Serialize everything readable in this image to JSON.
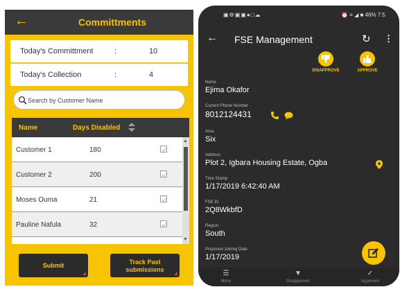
{
  "left_screen": {
    "title": "Committments",
    "stats": [
      {
        "label": "Today's Committment",
        "sep": ":",
        "value": "10"
      },
      {
        "label": "Today's Collection",
        "sep": ":",
        "value": "4"
      }
    ],
    "search": {
      "placeholder": "Search by Customer Name"
    },
    "table": {
      "headers": {
        "name": "Name",
        "days": "Days Disabled"
      },
      "rows": [
        {
          "name": "Customer 1",
          "days": "180"
        },
        {
          "name": "Customer 2",
          "days": "200"
        },
        {
          "name": "Moses Ouma",
          "days": "21"
        },
        {
          "name": "Pauline Nafula",
          "days": "32"
        }
      ]
    },
    "buttons": {
      "submit": "Submit",
      "track_line1": "Track Past",
      "track_line2": "submissions"
    }
  },
  "right_screen": {
    "status_left": "▣⚙▣▣●□☁",
    "status_right": "⏰ ≡ ◢ ■ 46% 7:5",
    "title": "FSE Management",
    "actions": {
      "disapprove": "DISAPPROVE",
      "approve": "APPROVE"
    },
    "fields": [
      {
        "label": "Name",
        "value": "Ejima Okafor"
      },
      {
        "label": "Current Phone Number",
        "value": "8012124431"
      },
      {
        "label": "Area",
        "value": "Six"
      },
      {
        "label": "Address",
        "value": "Plot 2, Igbara Housing Estate, Ogba"
      },
      {
        "label": "Time Stamp",
        "value": "1/17/2019 6:42:40 AM"
      },
      {
        "label": "FSE ID",
        "value": "2Q8WkbfD"
      },
      {
        "label": "Region",
        "value": "South"
      },
      {
        "label": "Proposed Joining Date",
        "value": "1/17/2019"
      }
    ],
    "bottom_nav": {
      "menu": "Menu",
      "disapproved": "Disapproved",
      "approved": "Approved"
    }
  },
  "colors": {
    "brand_yellow": "#f8c400",
    "dark": "#2b2b2b"
  }
}
